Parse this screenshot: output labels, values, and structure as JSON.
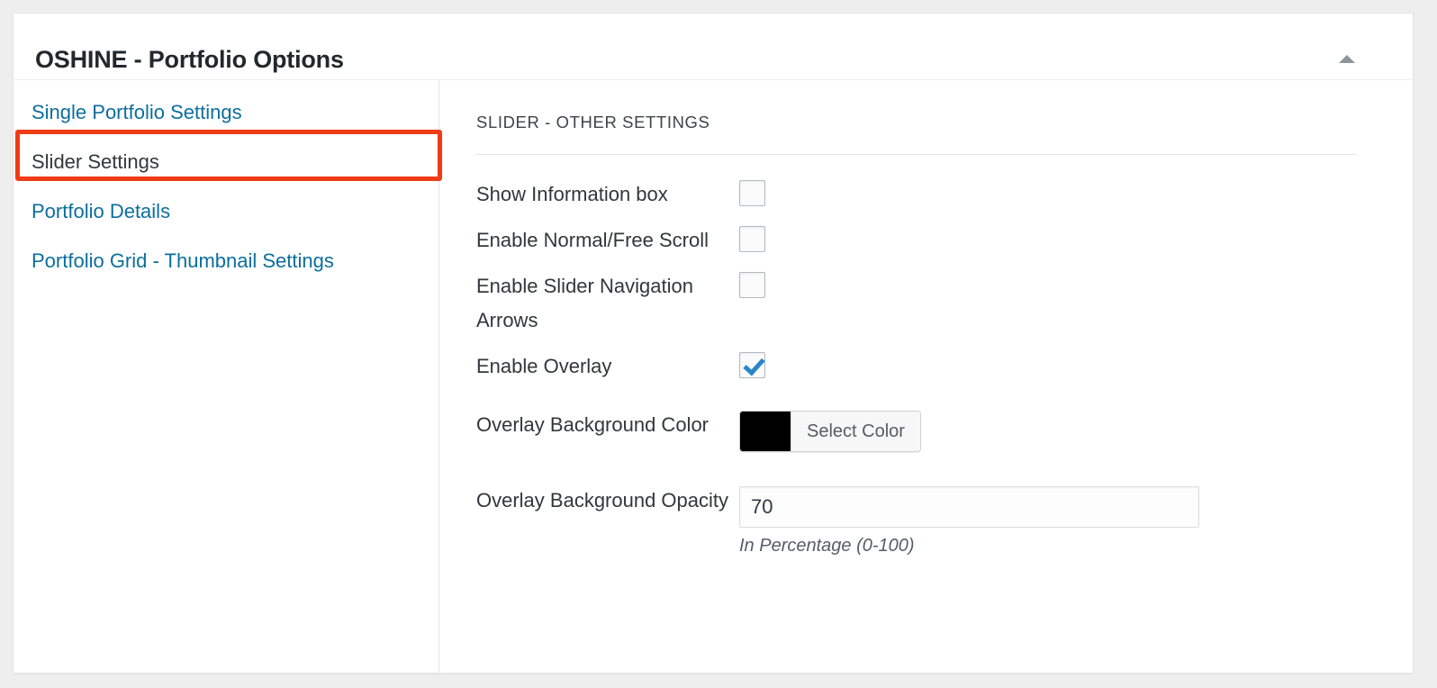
{
  "panel": {
    "title": "OSHINE - Portfolio Options",
    "collapse_icon": "triangle-up-icon",
    "accent_highlight_color": "#f03c16",
    "link_color": "#0b6e9d"
  },
  "sidebar": {
    "items": [
      {
        "label": "Single Portfolio Settings",
        "active": false
      },
      {
        "label": "Slider Settings",
        "active": true
      },
      {
        "label": "Portfolio Details",
        "active": false
      },
      {
        "label": "Portfolio Grid - Thumbnail Settings",
        "active": false
      }
    ]
  },
  "settings": {
    "section_title": "SLIDER - OTHER SETTINGS",
    "fields": {
      "show_information_box": {
        "label": "Show Information box",
        "checked": false
      },
      "enable_normal_free_scroll": {
        "label": "Enable Normal/Free Scroll",
        "checked": false
      },
      "enable_slider_navigation_arrows": {
        "label": "Enable Slider Navigation Arrows",
        "checked": false
      },
      "enable_overlay": {
        "label": "Enable Overlay",
        "checked": true
      },
      "overlay_background_color": {
        "label": "Overlay Background Color",
        "button_label": "Select Color",
        "value": "#000000"
      },
      "overlay_background_opacity": {
        "label": "Overlay Background Opacity",
        "value": "70",
        "placeholder": "",
        "help": "In Percentage (0-100)"
      }
    }
  }
}
